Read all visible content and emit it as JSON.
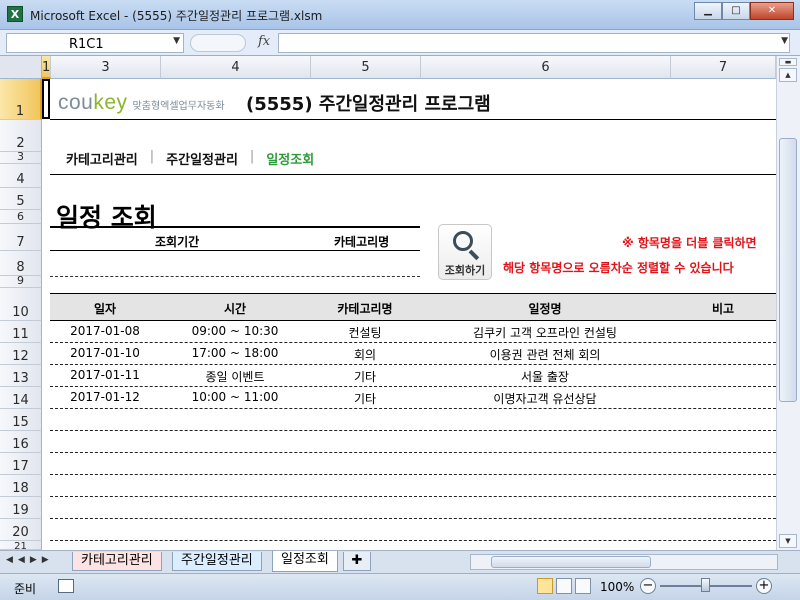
{
  "window": {
    "title": "Microsoft Excel - (5555) 주간일정관리 프로그램.xlsm",
    "app_icon": "excel-icon"
  },
  "formula_bar": {
    "name_box": "R1C1",
    "fx_label": "fx",
    "formula": ""
  },
  "columns": [
    "1",
    "3",
    "4",
    "5",
    "6",
    "7"
  ],
  "rows": [
    "1",
    "2",
    "3",
    "4",
    "5",
    "6",
    "7",
    "8",
    "9",
    "10",
    "11",
    "12",
    "13",
    "14",
    "15",
    "16",
    "17",
    "18",
    "19",
    "20",
    "21"
  ],
  "sheet": {
    "brand_logo_co": "cou",
    "brand_logo_key": "key",
    "brand_sub": "맞춤형엑셀업무자동화",
    "program_title": "(5555) 주간일정관리 프로그램",
    "menu": [
      "카테고리관리",
      "주간일정관리",
      "일정조회"
    ],
    "menu_separator": "|",
    "page_heading": "일정 조회",
    "filter": {
      "period_label": "조회기간",
      "category_label": "카테고리명"
    },
    "search_button": "조회하기",
    "note_line1": "※ 항목명을 더블 클릭하면",
    "note_line2": "해당 항목명으로 오름차순 정렬할 수 있습니다",
    "table": {
      "headers": [
        "일자",
        "시간",
        "카테고리명",
        "일정명",
        "비고"
      ],
      "rows": [
        [
          "2017-01-08",
          "09:00 ~ 10:30",
          "컨설팅",
          "김쿠키 고객 오프라인 컨설팅",
          ""
        ],
        [
          "2017-01-10",
          "17:00 ~ 18:00",
          "회의",
          "이용권 관련 전체 회의",
          ""
        ],
        [
          "2017-01-11",
          "종일 이벤트",
          "기타",
          "서울 출장",
          ""
        ],
        [
          "2017-01-12",
          "10:00 ~ 11:00",
          "기타",
          "이명자고객 유선상담",
          ""
        ]
      ]
    }
  },
  "tabs": [
    "카테고리관리",
    "주간일정관리",
    "일정조회"
  ],
  "status": {
    "ready": "준비",
    "zoom": "100%"
  },
  "colors": {
    "active_menu": "#2e9b3a",
    "note": "#e2141a",
    "brand_green": "#8bb531",
    "tab1": "#fde3e3",
    "tab2": "#dbeeff"
  }
}
